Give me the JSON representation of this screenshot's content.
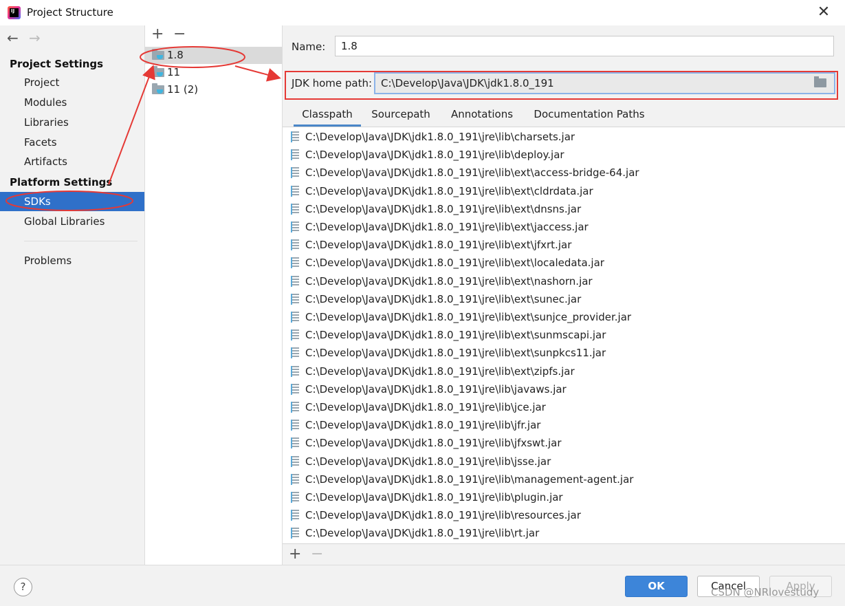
{
  "window": {
    "title": "Project Structure",
    "app_icon_text": "IJ"
  },
  "nav": {
    "back_icon": "←",
    "forward_icon": "→",
    "project_settings_heading": "Project Settings",
    "project_settings_items": [
      "Project",
      "Modules",
      "Libraries",
      "Facets",
      "Artifacts"
    ],
    "platform_settings_heading": "Platform Settings",
    "platform_settings_items": [
      "SDKs",
      "Global Libraries"
    ],
    "problems": "Problems",
    "selected": "SDKs"
  },
  "sdk_list": {
    "add": "+",
    "remove": "−",
    "items": [
      "1.8",
      "11",
      "11 (2)"
    ],
    "selected": "1.8"
  },
  "detail": {
    "name_label": "Name:",
    "name_value": "1.8",
    "jdk_home_label": "JDK home path:",
    "jdk_home_value": "C:\\Develop\\Java\\JDK\\jdk1.8.0_191",
    "tabs": [
      "Classpath",
      "Sourcepath",
      "Annotations",
      "Documentation Paths"
    ],
    "active_tab": "Classpath",
    "classpath": [
      "C:\\Develop\\Java\\JDK\\jdk1.8.0_191\\jre\\lib\\charsets.jar",
      "C:\\Develop\\Java\\JDK\\jdk1.8.0_191\\jre\\lib\\deploy.jar",
      "C:\\Develop\\Java\\JDK\\jdk1.8.0_191\\jre\\lib\\ext\\access-bridge-64.jar",
      "C:\\Develop\\Java\\JDK\\jdk1.8.0_191\\jre\\lib\\ext\\cldrdata.jar",
      "C:\\Develop\\Java\\JDK\\jdk1.8.0_191\\jre\\lib\\ext\\dnsns.jar",
      "C:\\Develop\\Java\\JDK\\jdk1.8.0_191\\jre\\lib\\ext\\jaccess.jar",
      "C:\\Develop\\Java\\JDK\\jdk1.8.0_191\\jre\\lib\\ext\\jfxrt.jar",
      "C:\\Develop\\Java\\JDK\\jdk1.8.0_191\\jre\\lib\\ext\\localedata.jar",
      "C:\\Develop\\Java\\JDK\\jdk1.8.0_191\\jre\\lib\\ext\\nashorn.jar",
      "C:\\Develop\\Java\\JDK\\jdk1.8.0_191\\jre\\lib\\ext\\sunec.jar",
      "C:\\Develop\\Java\\JDK\\jdk1.8.0_191\\jre\\lib\\ext\\sunjce_provider.jar",
      "C:\\Develop\\Java\\JDK\\jdk1.8.0_191\\jre\\lib\\ext\\sunmscapi.jar",
      "C:\\Develop\\Java\\JDK\\jdk1.8.0_191\\jre\\lib\\ext\\sunpkcs11.jar",
      "C:\\Develop\\Java\\JDK\\jdk1.8.0_191\\jre\\lib\\ext\\zipfs.jar",
      "C:\\Develop\\Java\\JDK\\jdk1.8.0_191\\jre\\lib\\javaws.jar",
      "C:\\Develop\\Java\\JDK\\jdk1.8.0_191\\jre\\lib\\jce.jar",
      "C:\\Develop\\Java\\JDK\\jdk1.8.0_191\\jre\\lib\\jfr.jar",
      "C:\\Develop\\Java\\JDK\\jdk1.8.0_191\\jre\\lib\\jfxswt.jar",
      "C:\\Develop\\Java\\JDK\\jdk1.8.0_191\\jre\\lib\\jsse.jar",
      "C:\\Develop\\Java\\JDK\\jdk1.8.0_191\\jre\\lib\\management-agent.jar",
      "C:\\Develop\\Java\\JDK\\jdk1.8.0_191\\jre\\lib\\plugin.jar",
      "C:\\Develop\\Java\\JDK\\jdk1.8.0_191\\jre\\lib\\resources.jar",
      "C:\\Develop\\Java\\JDK\\jdk1.8.0_191\\jre\\lib\\rt.jar"
    ],
    "add": "+",
    "remove": "−"
  },
  "footer": {
    "help": "?",
    "ok": "OK",
    "cancel": "Cancel",
    "apply": "Apply",
    "watermark": "CSDN @NRlovestudy"
  },
  "colors": {
    "selection": "#2f70c9",
    "annotation_red": "#e53935",
    "ok_button": "#3d85d9"
  }
}
